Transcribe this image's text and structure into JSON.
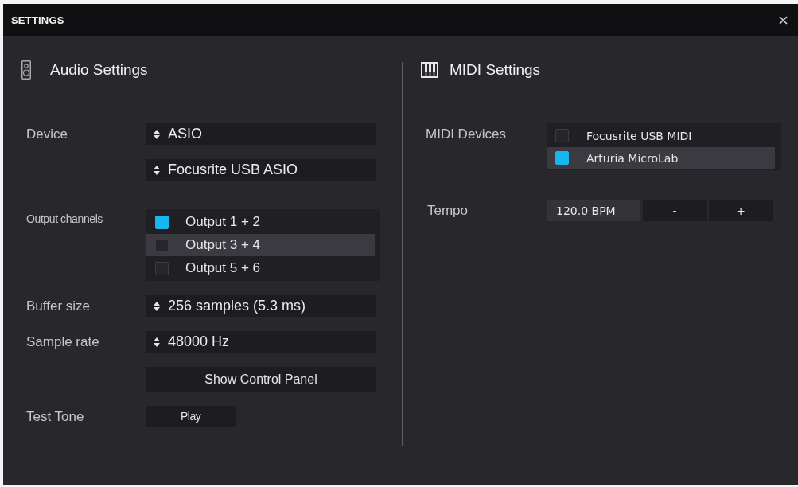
{
  "window": {
    "title": "SETTINGS"
  },
  "audio": {
    "heading": "Audio Settings",
    "rows": [
      {
        "kind": "select",
        "label": "Device",
        "values": [
          "ASIO",
          "Focusrite USB ASIO"
        ]
      },
      {
        "kind": "checklist",
        "label": "Output channels",
        "items": [
          {
            "label": "Output 1 + 2",
            "checked": true,
            "selected": false
          },
          {
            "label": "Output 3 + 4",
            "checked": false,
            "selected": true
          },
          {
            "label": "Output 5 + 6",
            "checked": false,
            "selected": false
          }
        ]
      },
      {
        "kind": "select",
        "label": "Buffer size",
        "values": [
          "256 samples (5.3 ms)"
        ]
      },
      {
        "kind": "select",
        "label": "Sample rate",
        "values": [
          "48000 Hz"
        ]
      },
      {
        "kind": "button",
        "button": "Show Control Panel"
      },
      {
        "kind": "button",
        "label": "Test Tone",
        "button": "Play"
      }
    ]
  },
  "midi": {
    "heading": "MIDI Settings",
    "devices": {
      "label": "MIDI Devices",
      "items": [
        {
          "label": "Focusrite USB MIDI",
          "checked": false,
          "selected": false
        },
        {
          "label": "Arturia MicroLab",
          "checked": true,
          "selected": true
        }
      ]
    },
    "tempo": {
      "label": "Tempo",
      "value": "120.0 BPM",
      "buttons": [
        "-",
        "+"
      ]
    }
  }
}
